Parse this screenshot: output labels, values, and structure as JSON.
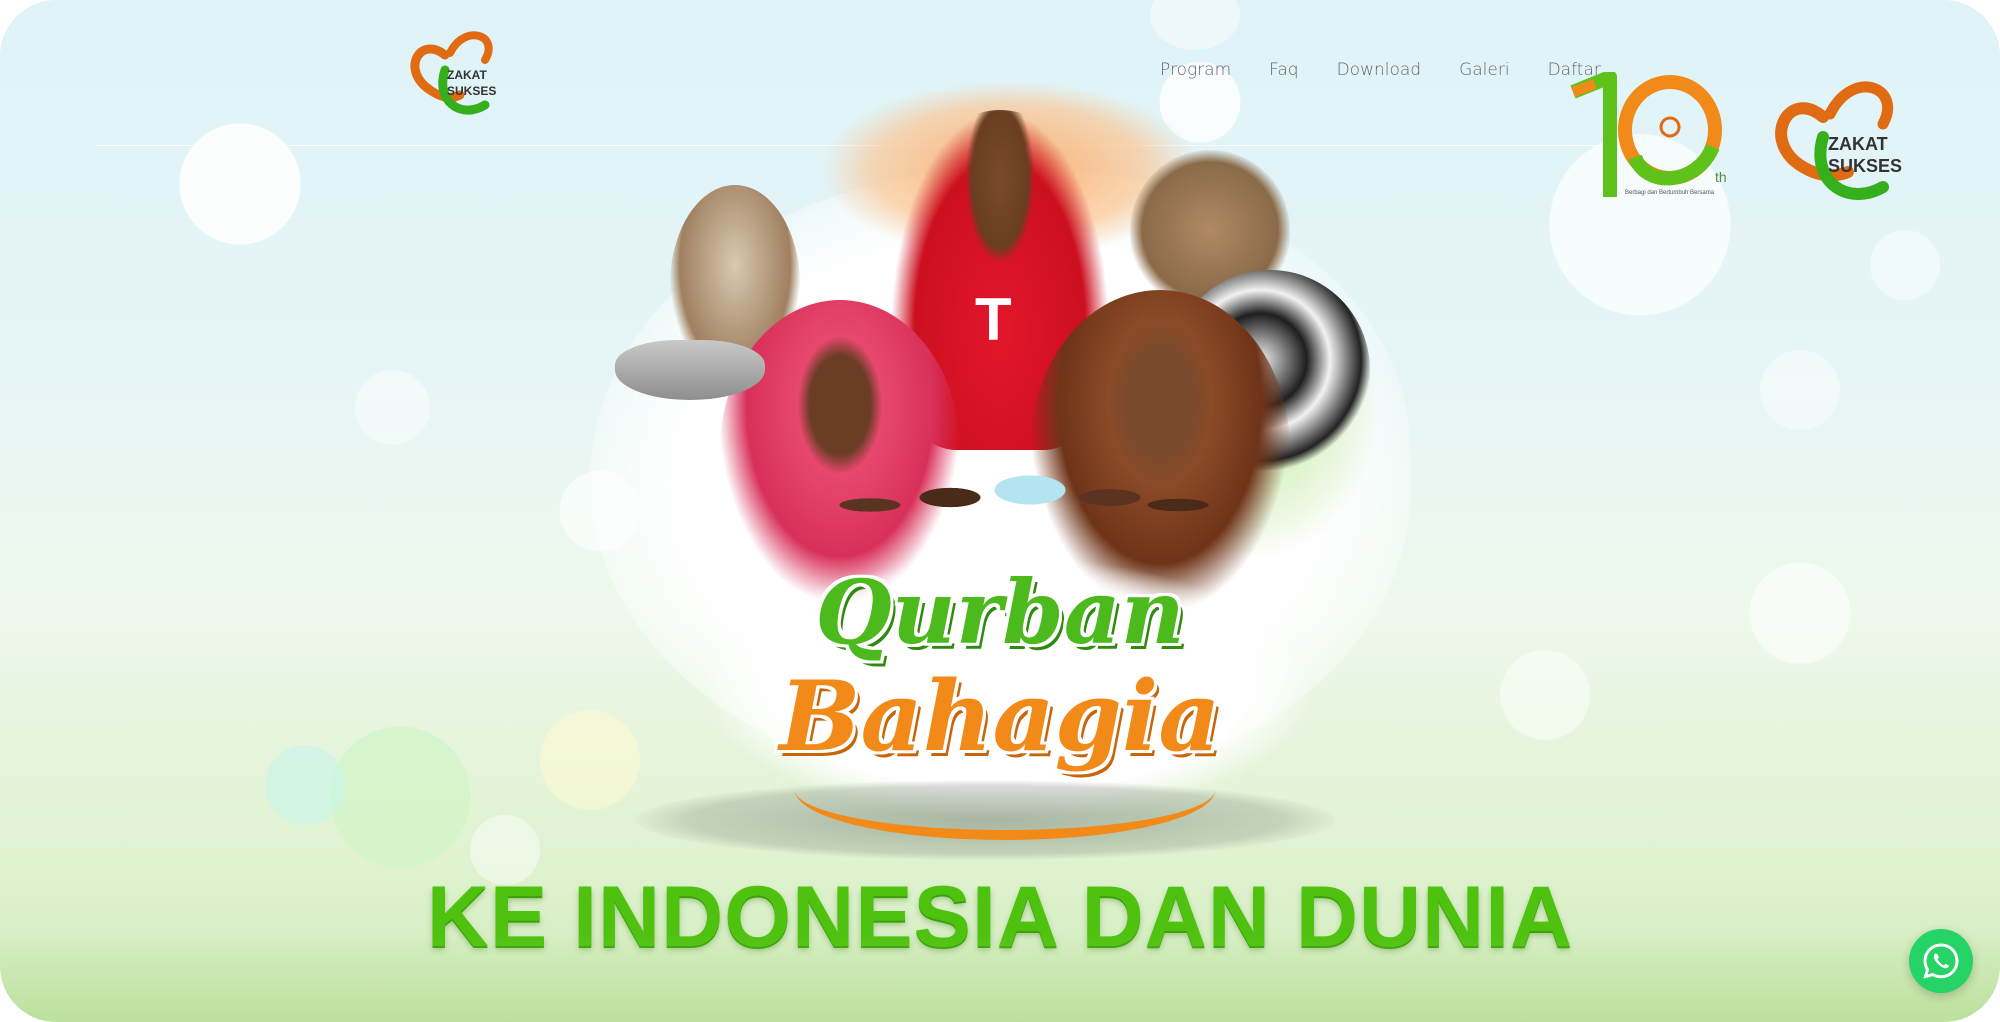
{
  "brand": {
    "logo_left_text": [
      "ZAKAT",
      "SUKSES"
    ],
    "logo_right_text": [
      "ZAKAT",
      "SUKSES"
    ],
    "anniversary": {
      "number": "10",
      "suffix": "th",
      "tagline": "Berbagi dan Bertumbuh Bersama"
    }
  },
  "nav": {
    "items": [
      "Program",
      "Faq",
      "Download",
      "Galeri",
      "Daftar"
    ]
  },
  "hero": {
    "title_line1": "Qurban",
    "title_line2": "Bahagia",
    "tagline": "KE INDONESIA DAN DUNIA",
    "jersey_letter": "T"
  },
  "colors": {
    "brand_green": "#4cba1c",
    "brand_orange": "#f28a1a",
    "whatsapp": "#25d366",
    "nav_text": "#666666"
  },
  "icons": {
    "whatsapp": "whatsapp-icon"
  }
}
